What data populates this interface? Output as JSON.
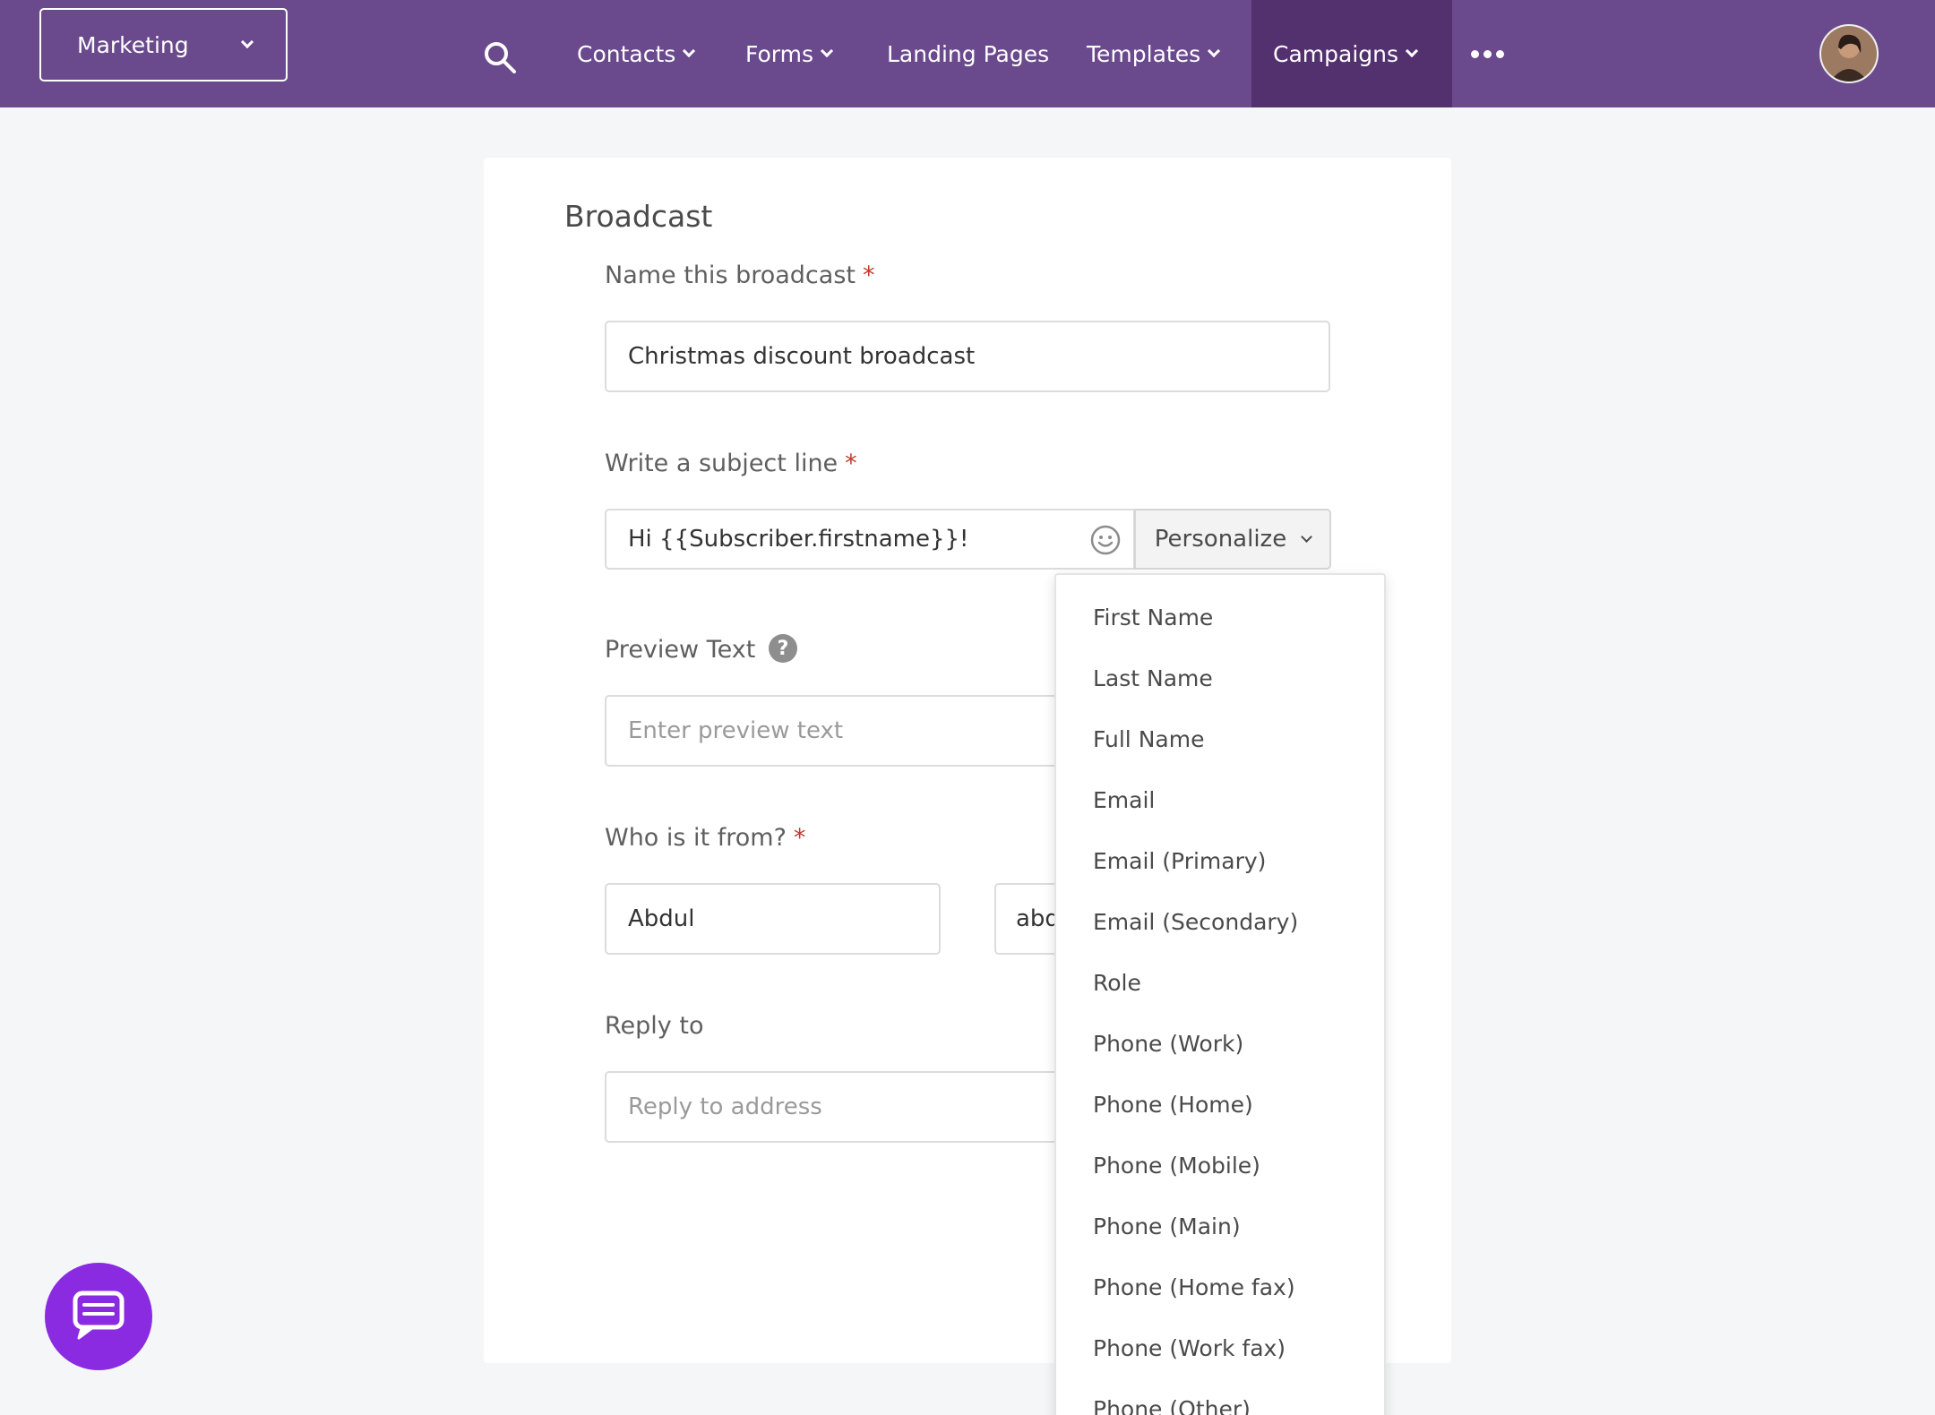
{
  "header": {
    "workspace_label": "Marketing",
    "nav": [
      {
        "label": "Contacts"
      },
      {
        "label": "Forms"
      },
      {
        "label": "Landing Pages"
      },
      {
        "label": "Templates"
      },
      {
        "label": "Campaigns"
      }
    ],
    "colors": {
      "bar": "#6a4a8c",
      "active": "#53306e"
    }
  },
  "form": {
    "section_title": "Broadcast",
    "name_label": "Name this broadcast",
    "name_value": "Christmas discount broadcast",
    "subject_label": "Write a subject line",
    "subject_value": "Hi {{Subscriber.firstname}}!",
    "personalize_label": "Personalize",
    "preview_label": "Preview Text",
    "preview_placeholder": "Enter preview text",
    "help_glyph": "?",
    "from_label": "Who is it from?",
    "from_name_value": "Abdul",
    "from_email_value": "abd",
    "reply_label": "Reply to",
    "reply_placeholder": "Reply to address",
    "required_mark": "*"
  },
  "personalize_menu": {
    "items": [
      "First Name",
      "Last Name",
      "Full Name",
      "Email",
      "Email (Primary)",
      "Email (Secondary)",
      "Role",
      "Phone (Work)",
      "Phone (Home)",
      "Phone (Mobile)",
      "Phone (Main)",
      "Phone (Home fax)",
      "Phone (Work fax)",
      "Phone (Other)"
    ]
  },
  "accent": "#8a2be2"
}
